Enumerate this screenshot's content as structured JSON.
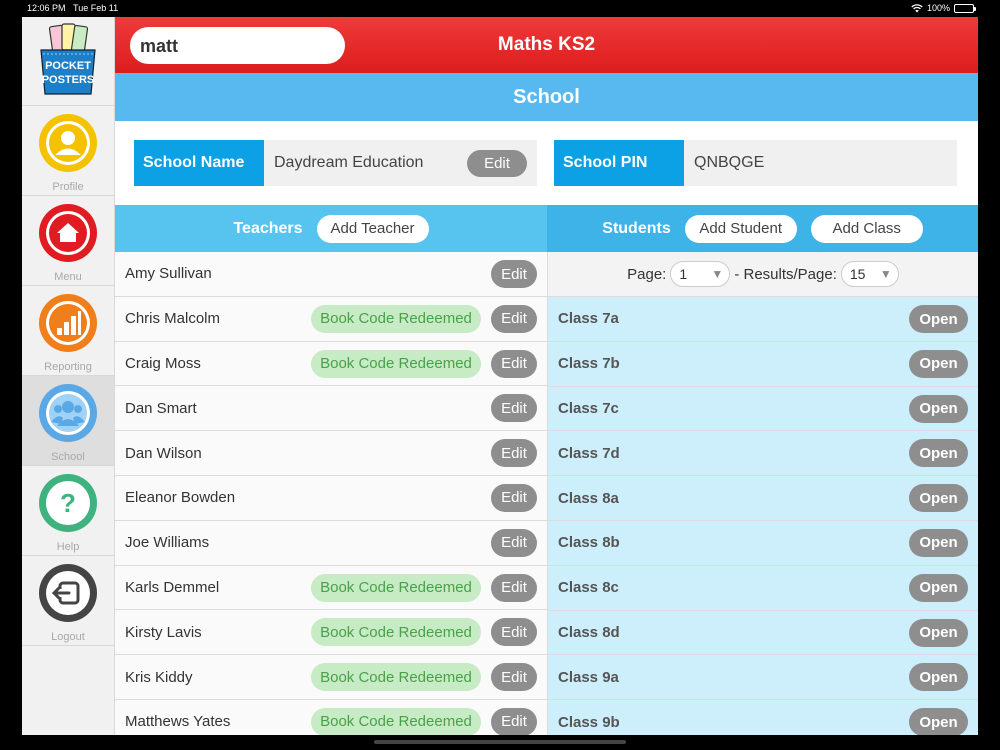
{
  "status": {
    "time": "12:06 PM",
    "date": "Tue Feb 11",
    "battery": "100%"
  },
  "logo": {
    "line1": "POCKET",
    "line2": "POSTERS"
  },
  "sidebar": {
    "items": [
      {
        "label": "Profile",
        "icon": "profile-icon",
        "color": "#f5c200"
      },
      {
        "label": "Menu",
        "icon": "home-icon",
        "color": "#e11b22"
      },
      {
        "label": "Reporting",
        "icon": "bar-chart-icon",
        "color": "#f07f1b"
      },
      {
        "label": "School",
        "icon": "group-icon",
        "color": "#5aa9e6"
      },
      {
        "label": "Help",
        "icon": "question-icon",
        "color": "#3fb27f"
      },
      {
        "label": "Logout",
        "icon": "logout-icon",
        "color": "#444444"
      }
    ],
    "active": "School"
  },
  "header": {
    "search_value": "matt",
    "title": "Maths KS2"
  },
  "subheader": {
    "title": "School"
  },
  "school_name": {
    "label": "School Name",
    "value": "Daydream Education",
    "edit_label": "Edit"
  },
  "school_pin": {
    "label": "School PIN",
    "value": "QNBQGE"
  },
  "teachers": {
    "heading": "Teachers",
    "add_label": "Add Teacher",
    "rows": [
      {
        "name": "Amy Sullivan",
        "badge": "",
        "edit": "Edit"
      },
      {
        "name": "Chris Malcolm",
        "badge": "Book Code Redeemed",
        "edit": "Edit"
      },
      {
        "name": "Craig Moss",
        "badge": "Book Code Redeemed",
        "edit": "Edit"
      },
      {
        "name": "Dan Smart",
        "badge": "",
        "edit": "Edit"
      },
      {
        "name": "Dan Wilson",
        "badge": "",
        "edit": "Edit"
      },
      {
        "name": "Eleanor Bowden",
        "badge": "",
        "edit": "Edit"
      },
      {
        "name": "Joe Williams",
        "badge": "",
        "edit": "Edit"
      },
      {
        "name": "Karls Demmel",
        "badge": "Book Code Redeemed",
        "edit": "Edit"
      },
      {
        "name": "Kirsty Lavis",
        "badge": "Book Code Redeemed",
        "edit": "Edit"
      },
      {
        "name": "Kris Kiddy",
        "badge": "Book Code Redeemed",
        "edit": "Edit"
      },
      {
        "name": "Matthews Yates",
        "badge": "Book Code Redeemed",
        "edit": "Edit"
      }
    ]
  },
  "students": {
    "heading": "Students",
    "add_student_label": "Add Student",
    "add_class_label": "Add Class",
    "page_label": "Page:",
    "page_value": "1",
    "results_label": "- Results/Page:",
    "results_value": "15",
    "rows": [
      {
        "name": "Class 7a",
        "open": "Open"
      },
      {
        "name": "Class 7b",
        "open": "Open"
      },
      {
        "name": "Class 7c",
        "open": "Open"
      },
      {
        "name": "Class 7d",
        "open": "Open"
      },
      {
        "name": "Class 8a",
        "open": "Open"
      },
      {
        "name": "Class 8b",
        "open": "Open"
      },
      {
        "name": "Class 8c",
        "open": "Open"
      },
      {
        "name": "Class 8d",
        "open": "Open"
      },
      {
        "name": "Class 9a",
        "open": "Open"
      },
      {
        "name": "Class 9b",
        "open": "Open"
      }
    ]
  }
}
